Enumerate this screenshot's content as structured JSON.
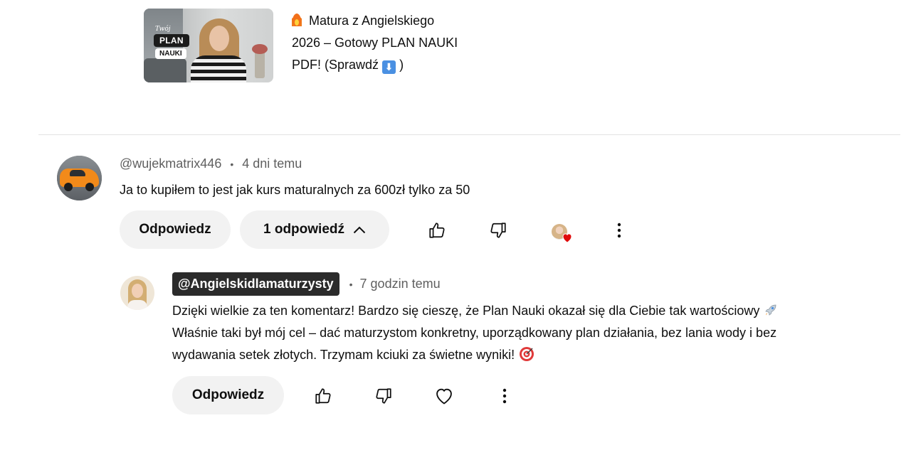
{
  "video": {
    "title_line1": "Matura z Angielskiego",
    "title_line2": "2026 – Gotowy PLAN NAUKI",
    "title_line3_text": "PDF! (Sprawdź",
    "title_line3_end": ")",
    "title_emoji_start": "fire-emoji",
    "title_emoji_end": "down-arrow-emoji",
    "thumbnail": {
      "small_text": "Twój",
      "pill1": "PLAN",
      "pill2": "NAUKI"
    }
  },
  "comment": {
    "author": "@wujekmatrix446",
    "separator": "•",
    "time": "4 dni temu",
    "text": "Ja to kupiłem to jest jak kurs maturalnych za 600zł tylko za 50",
    "reply_label": "Odpowiedz",
    "replies_label": "1 odpowiedź",
    "icons": [
      "thumbs-up-icon",
      "thumbs-down-icon",
      "creator-heart-icon",
      "more-vertical-icon"
    ]
  },
  "reply": {
    "author": "@Angielskidlamaturzysty",
    "separator": "•",
    "time": "7 godzin temu",
    "line1": "Dzięki wielkie za ten komentarz! Bardzo się cieszę, że Plan Nauki okazał się dla Ciebie tak wartościowy",
    "line1_emoji": "rocket-emoji",
    "line2": "Właśnie taki był mój cel – dać maturzystom konkretny, uporządkowany plan działania, bez lania wody i bez",
    "line3": "wydawania setek złotych. Trzymam kciuki za świetne wyniki!",
    "line3_emoji": "target-emoji",
    "reply_label": "Odpowiedz",
    "icons": [
      "thumbs-up-icon",
      "thumbs-down-icon",
      "heart-outline-icon",
      "more-vertical-icon"
    ]
  },
  "colors": {
    "text_primary": "#0f0f0f",
    "text_secondary": "#606060",
    "pill_bg": "#f2f2f2",
    "author_chip_bg": "#2b2b2b",
    "creator_heart": "#e00b0b"
  }
}
